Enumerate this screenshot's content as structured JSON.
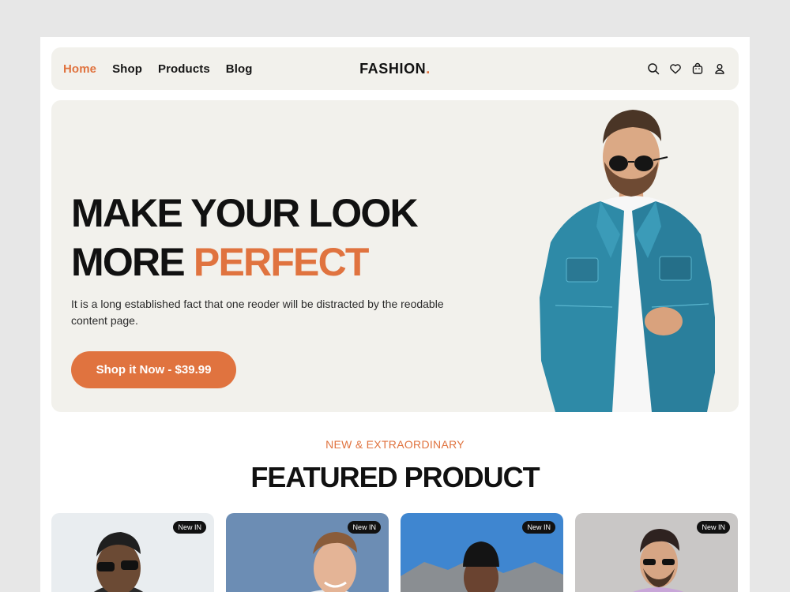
{
  "nav": {
    "links": [
      {
        "label": "Home",
        "active": true
      },
      {
        "label": "Shop"
      },
      {
        "label": "Products"
      },
      {
        "label": "Blog"
      }
    ],
    "logo": "FASHION",
    "logo_dot": ".",
    "icons": [
      "search-icon",
      "heart-icon",
      "bag-icon",
      "user-icon"
    ]
  },
  "hero": {
    "title_line1": "MAKE YOUR LOOK",
    "title_line2_plain": "MORE",
    "title_line2_accent": "PERFECT",
    "description": "It is a long established fact that one reoder will be distracted by the reodable content page.",
    "cta_label": "Shop it Now - $39.99"
  },
  "featured": {
    "eyebrow": "NEW & EXTRAORDINARY",
    "title": "FEATURED PRODUCT",
    "products": [
      {
        "badge": "New IN"
      },
      {
        "badge": "New IN"
      },
      {
        "badge": "New IN"
      },
      {
        "badge": "New IN"
      }
    ]
  },
  "colors": {
    "accent": "#e0733f",
    "panel": "#f2f1ec",
    "text": "#111111"
  }
}
